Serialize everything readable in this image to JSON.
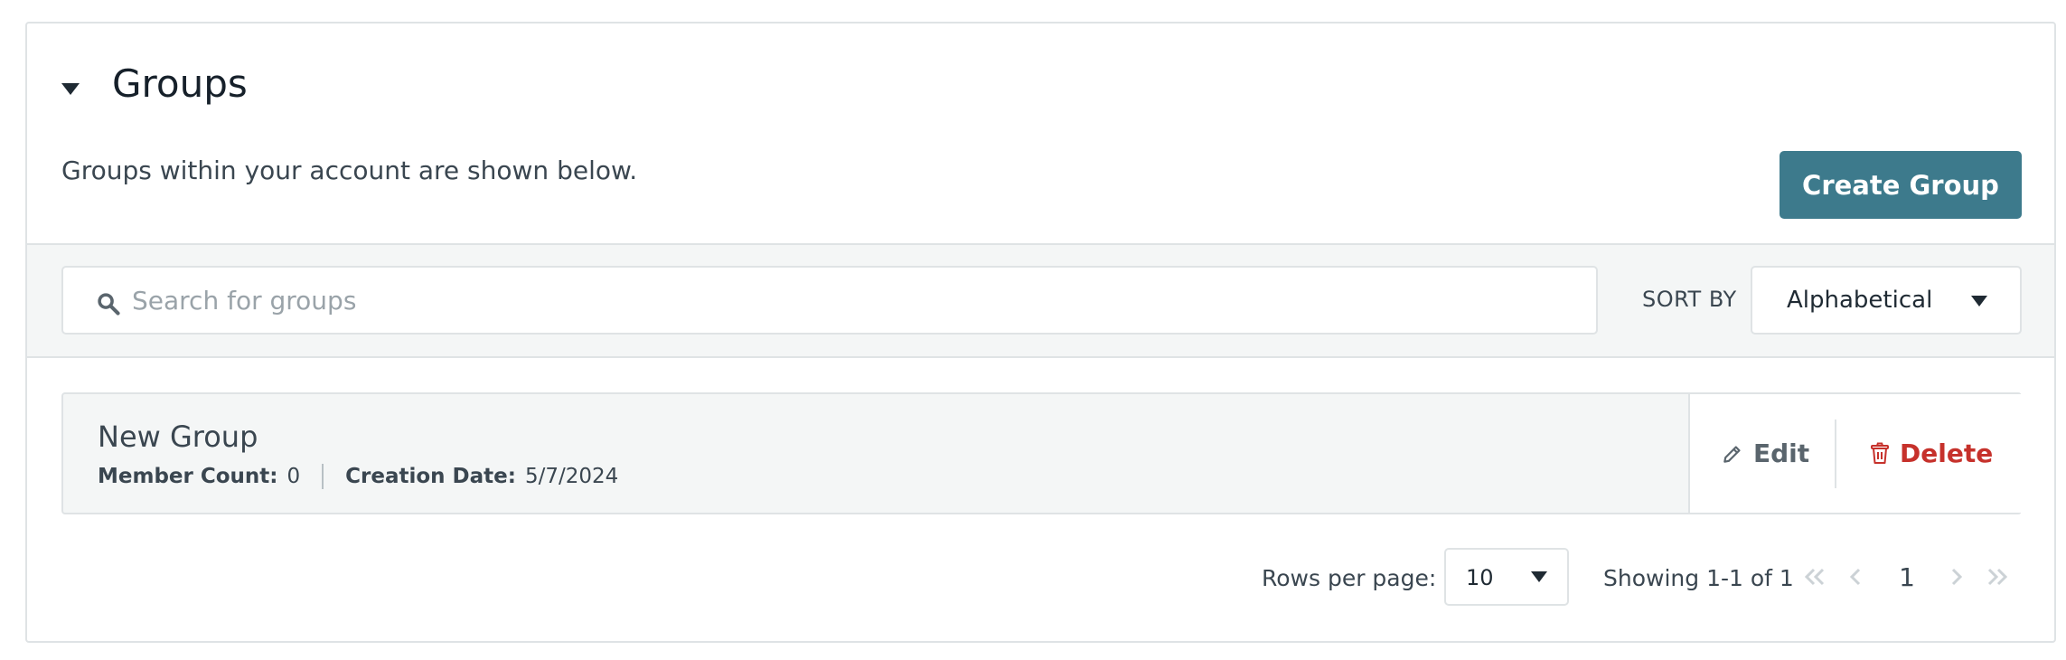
{
  "section": {
    "title": "Groups",
    "description": "Groups within your account are shown below.",
    "create_button": "Create Group"
  },
  "search": {
    "placeholder": "Search for groups",
    "value": ""
  },
  "sort": {
    "label": "SORT BY",
    "selected": "Alphabetical"
  },
  "groups": [
    {
      "name": "New Group",
      "member_count_label": "Member Count:",
      "member_count": "0",
      "creation_date_label": "Creation Date:",
      "creation_date": "5/7/2024",
      "edit_label": "Edit",
      "delete_label": "Delete"
    }
  ],
  "pagination": {
    "rows_per_page_label": "Rows per page:",
    "rows_per_page": "10",
    "showing": "Showing 1-1 of 1",
    "current_page": "1"
  },
  "colors": {
    "primary_button": "#3d7a8c",
    "delete": "#c6312b",
    "toolbar_bg": "#f4f6f6",
    "border": "#dfe3e5"
  },
  "icons": {
    "collapse": "caret-down-icon",
    "search": "search-icon",
    "edit": "pencil-icon",
    "delete": "trash-icon",
    "first": "double-chevron-left-icon",
    "prev": "chevron-left-icon",
    "next": "chevron-right-icon",
    "last": "double-chevron-right-icon"
  }
}
